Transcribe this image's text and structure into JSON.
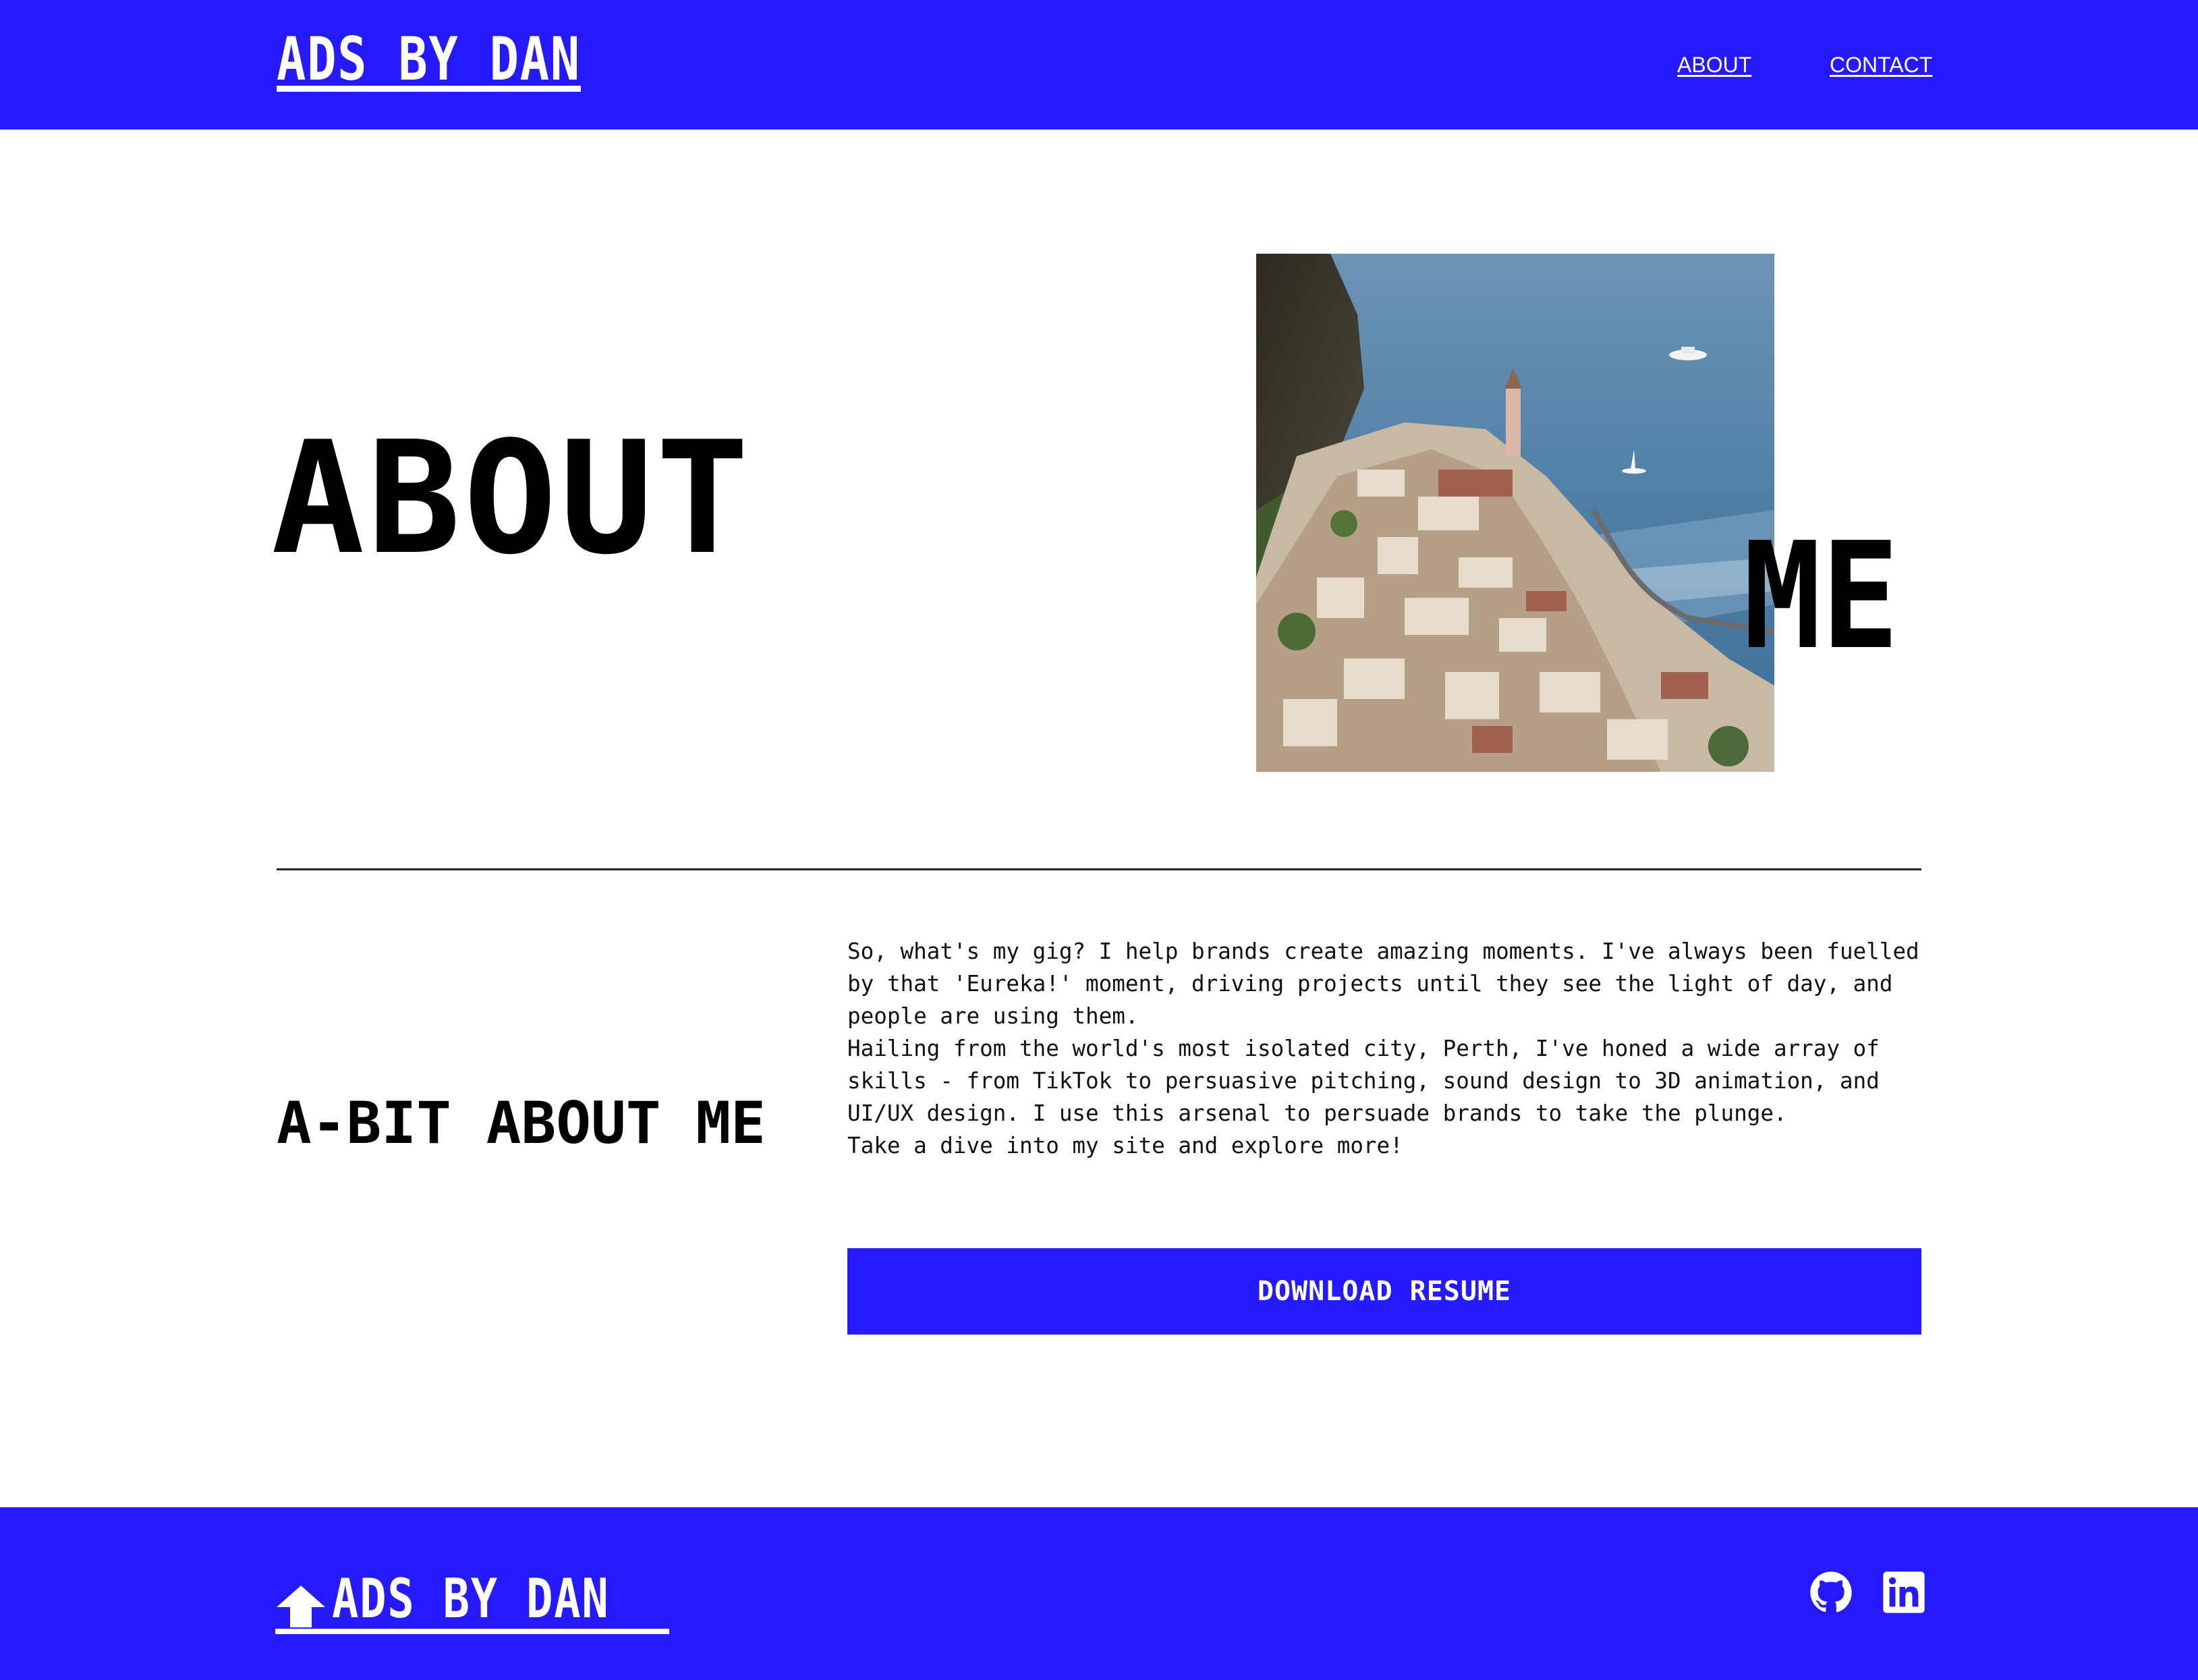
{
  "header": {
    "brand": "ADS BY DAN",
    "nav": [
      {
        "label": "ABOUT"
      },
      {
        "label": "CONTACT"
      }
    ]
  },
  "hero": {
    "title_left": "ABOUT",
    "title_right": "ME",
    "photo_icon": "coastal-town-photo"
  },
  "bio": {
    "heading": "A-BIT ABOUT ME",
    "paragraphs": [
      "So, what's my gig? I help brands create amazing moments. I've always been fuelled",
      "by that 'Eureka!' moment, driving projects until they see the light of day, and",
      "people are using them.",
      "Hailing from the world's most isolated city, Perth, I've honed a wide array of",
      "skills - from TikTok to persuasive pitching, sound design to 3D animation, and",
      "UI/UX design. I use this arsenal to persuade brands to take the plunge.",
      "Take a dive into my site and explore more!"
    ],
    "resume_button": "DOWNLOAD RESUME"
  },
  "footer": {
    "brand": "ADS BY DAN",
    "icons": [
      "arrow-up-icon",
      "github-icon",
      "linkedin-icon"
    ]
  },
  "colors": {
    "accent": "#2419ff",
    "text": "#000000",
    "background": "#ffffff"
  }
}
